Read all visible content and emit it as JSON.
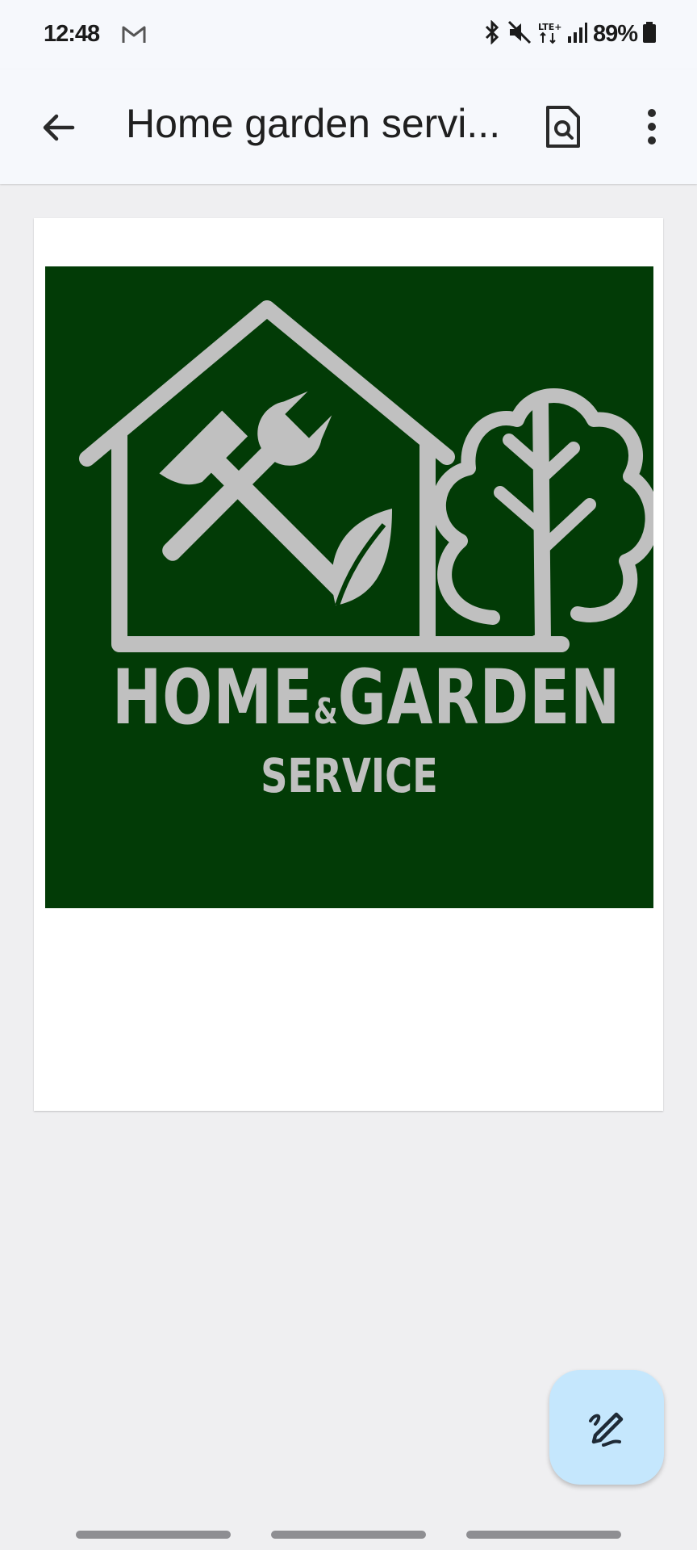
{
  "status_bar": {
    "time": "12:48",
    "battery": "89%",
    "notification_icons": [
      "gmail-icon"
    ],
    "system_icons": [
      "bluetooth-icon",
      "mute-icon",
      "lte-icon",
      "signal-icon",
      "battery-icon"
    ]
  },
  "app_bar": {
    "title": "Home garden servi..."
  },
  "document": {
    "logo": {
      "line1_a": "HOME",
      "line1_amp": "&",
      "line1_b": "GARDEN",
      "line2": "SERVICE",
      "background": "#023b06",
      "foreground": "#c0c0c0"
    }
  },
  "fab": {
    "icon": "edit-pen-icon",
    "color": "#c5e7fd"
  }
}
